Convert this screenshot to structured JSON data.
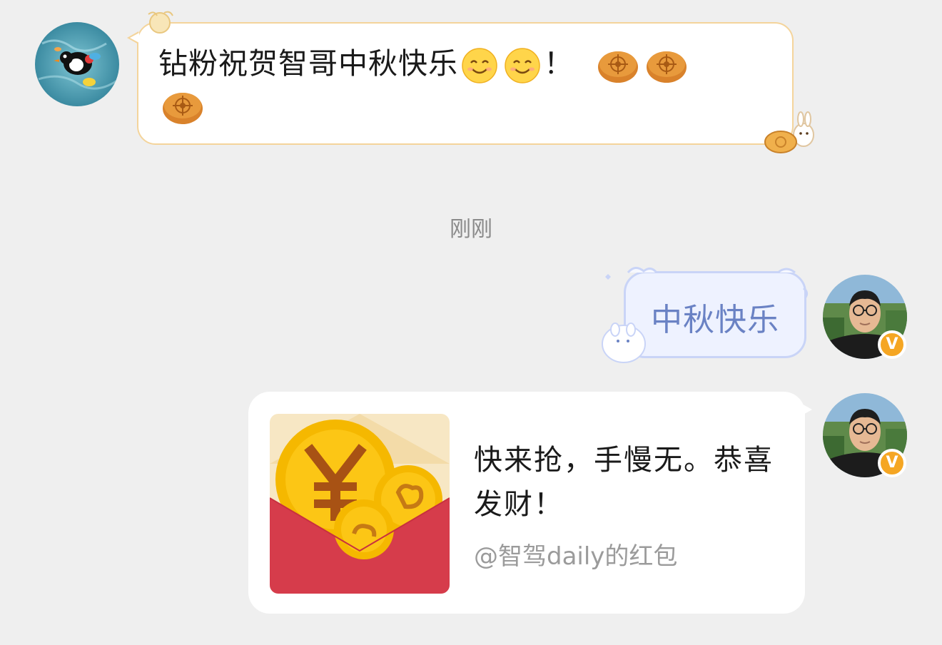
{
  "messages": {
    "incoming": {
      "text": "钻粉祝贺智哥中秋快乐",
      "after_emoji_text": "！",
      "emojis": [
        "smile-emoji",
        "smile-emoji",
        "mooncake-emoji",
        "mooncake-emoji",
        "mooncake-emoji"
      ]
    },
    "timestamp": "刚刚",
    "outgoing_text": "中秋快乐",
    "red_packet": {
      "title": "快来抢，手慢无。恭喜发财！",
      "subtitle": "@智驾daily的红包"
    }
  },
  "badge": {
    "label": "V"
  },
  "colors": {
    "background": "#efefef",
    "incoming_border": "#f4d49b",
    "cloud_bubble": "#eef2ff",
    "cloud_text": "#6a82c4",
    "envelope_red": "#d63c4b",
    "coin_gold": "#f5b800",
    "badge_orange": "#f5a623"
  }
}
